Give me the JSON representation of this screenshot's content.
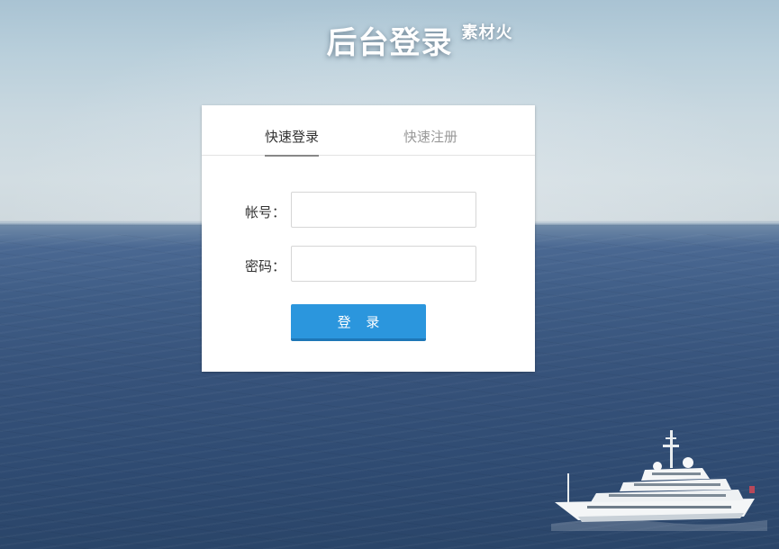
{
  "header": {
    "title": "后台登录",
    "watermark": "素材火"
  },
  "login_panel": {
    "tabs": [
      {
        "label": "快速登录",
        "active": true
      },
      {
        "label": "快速注册",
        "active": false
      }
    ],
    "account": {
      "label": "帐号：",
      "value": "",
      "placeholder": ""
    },
    "password": {
      "label": "密码：",
      "value": "",
      "placeholder": ""
    },
    "submit_label": "登 录"
  },
  "colors": {
    "accent": "#2b96dd",
    "accent_dark": "#1e77b7",
    "sea": "#36527a",
    "sky": "#c9d8e0"
  }
}
